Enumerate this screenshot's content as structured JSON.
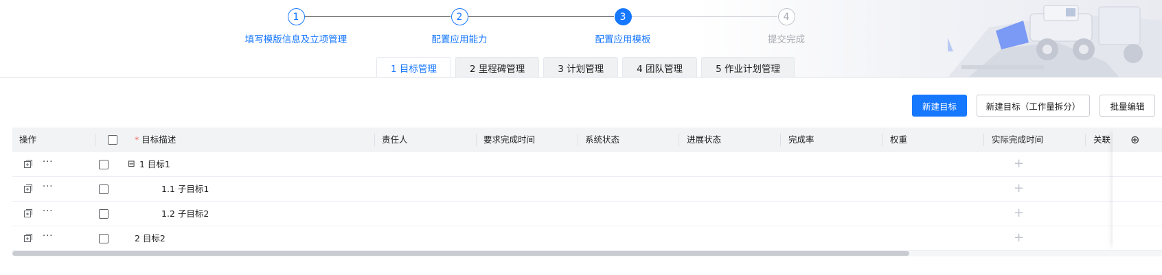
{
  "steps": [
    {
      "number": "1",
      "title": "填写模版信息及立项管理",
      "state": "done"
    },
    {
      "number": "2",
      "title": "配置应用能力",
      "state": "done"
    },
    {
      "number": "3",
      "title": "配置应用模板",
      "state": "active"
    },
    {
      "number": "4",
      "title": "提交完成",
      "state": "pending"
    }
  ],
  "tabs": [
    "1 目标管理",
    "2 里程碑管理",
    "3 计划管理",
    "4 团队管理",
    "5 作业计划管理"
  ],
  "toolbar": {
    "new_target": "新建目标",
    "new_target_split": "新建目标（工作量拆分）",
    "batch_edit": "批量编辑"
  },
  "table": {
    "headers": {
      "ops": "操作",
      "desc": "目标描述",
      "owner": "责任人",
      "due": "要求完成时间",
      "system_status": "系统状态",
      "progress_status": "进展状态",
      "completion": "完成率",
      "weight": "权重",
      "actual_finish": "实际完成时间",
      "related": "关联"
    },
    "required_mark": "*",
    "more_glyph": "···",
    "plus_glyph": "+",
    "collapse_glyph": "⊟",
    "add_col_glyph": "⊕",
    "rows": [
      {
        "label": "1 目标1"
      },
      {
        "label": "1.1 子目标1"
      },
      {
        "label": "1.2 子目标2"
      },
      {
        "label": "2 目标2"
      }
    ]
  },
  "colors": {
    "primary": "#1677ff",
    "header_bg": "#f2f3f5",
    "required": "#f56c6c"
  }
}
